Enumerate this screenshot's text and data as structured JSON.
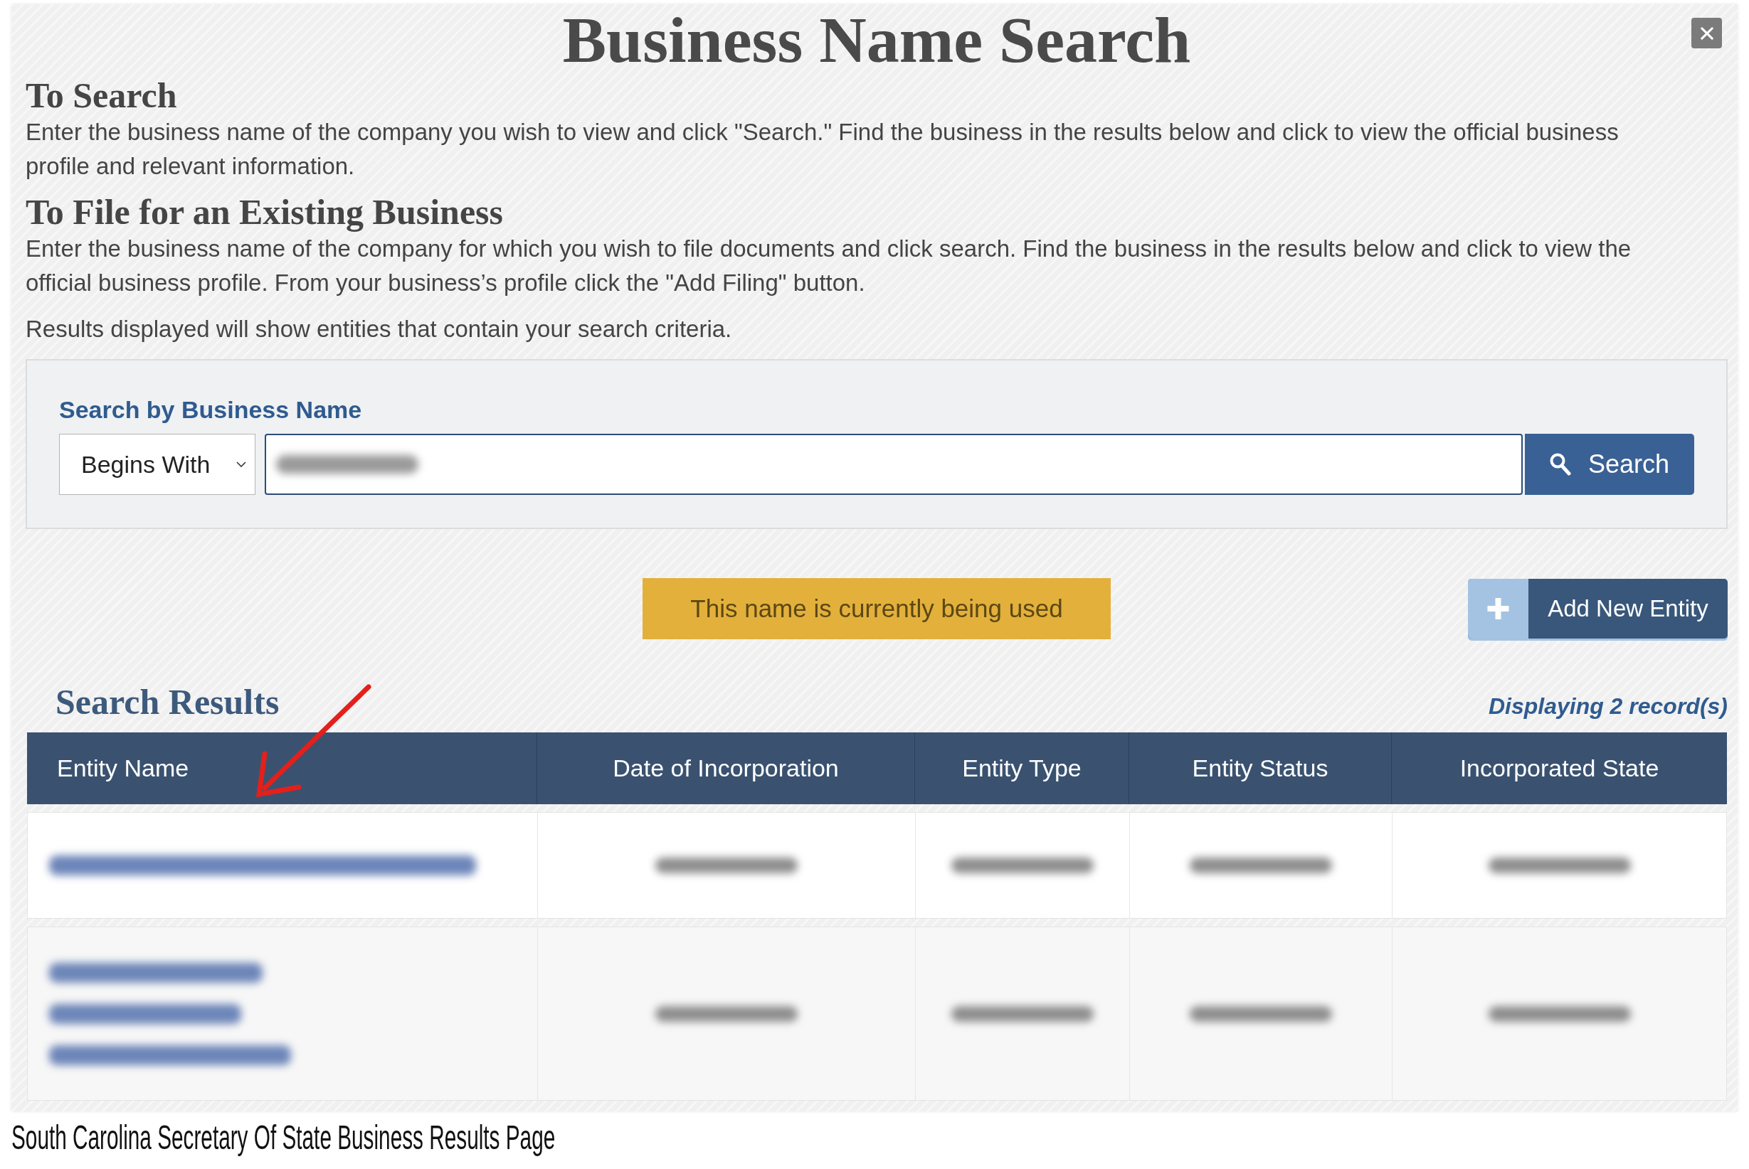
{
  "dialog": {
    "title": "Business Name Search",
    "sections": [
      {
        "heading": "To Search",
        "text": "Enter the business name of the company you wish to view and click \"Search.\" Find the business in the results below and click to view the official business profile and relevant information."
      },
      {
        "heading": "To File for an Existing Business",
        "text": "Enter the business name of the company for which you wish to file documents and click search. Find the business in the results below and click to view the official business profile. From your business’s profile click the \"Add Filing\" button."
      }
    ],
    "note": "Results displayed will show entities that contain your search criteria."
  },
  "search": {
    "label": "Search by Business Name",
    "match_mode": "Begins With",
    "value_blurred": true,
    "button": "Search"
  },
  "alert": {
    "kind": "warning",
    "text": "This name is currently being used"
  },
  "add_button": "Add New Entity",
  "results": {
    "heading": "Search Results",
    "count": "Displaying 2 record(s)",
    "columns": [
      "Entity Name",
      "Date of Incorporation",
      "Entity Type",
      "Entity Status",
      "Incorporated State"
    ],
    "rows": [
      {
        "kind": "blurred",
        "wrapped": false
      },
      {
        "kind": "blurred",
        "wrapped": true
      }
    ]
  },
  "caption": "South Carolina Secretary Of State Business Results Page"
}
